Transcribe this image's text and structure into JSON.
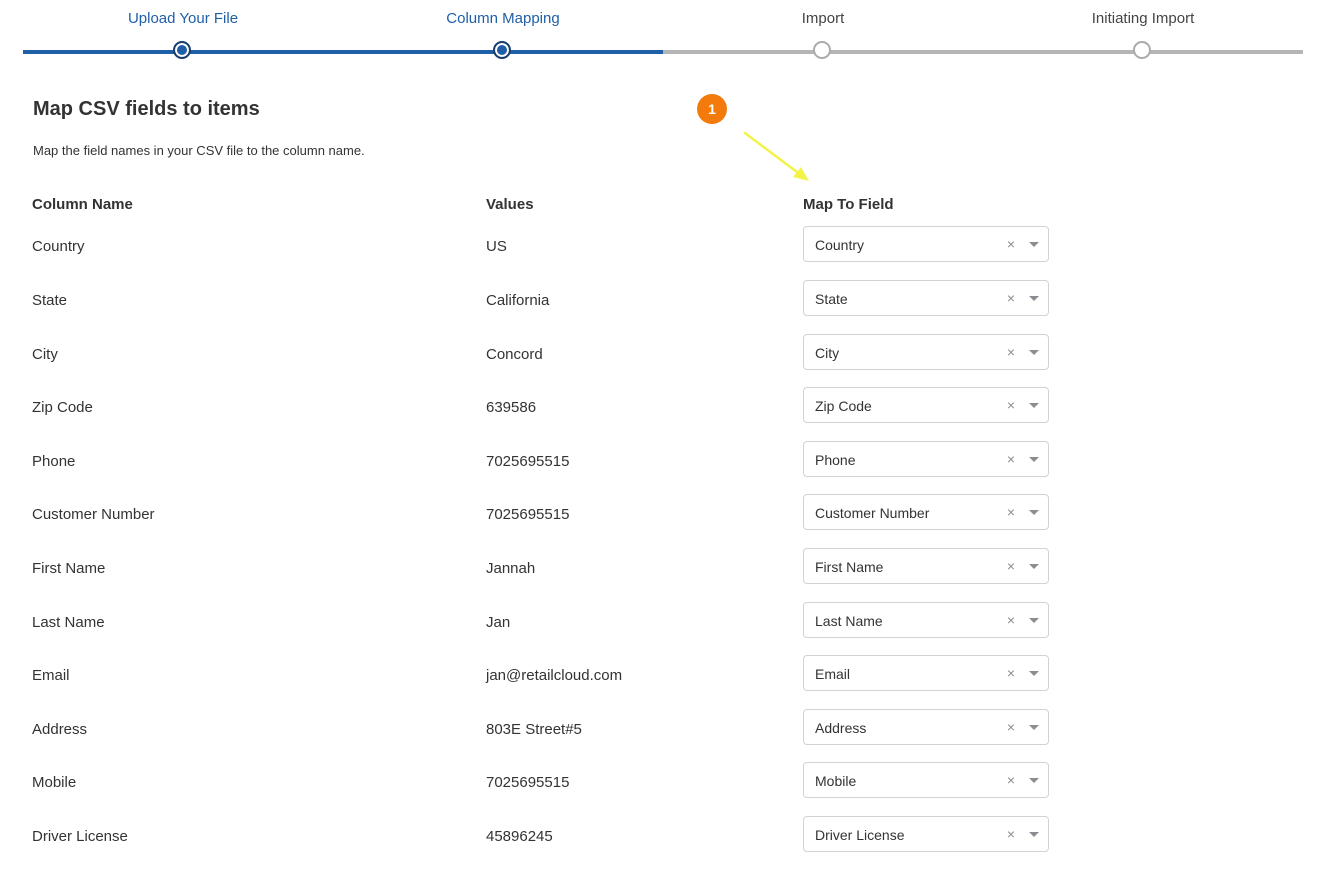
{
  "stepper": {
    "steps": [
      {
        "label": "Upload Your File",
        "state": "done"
      },
      {
        "label": "Column Mapping",
        "state": "done"
      },
      {
        "label": "Import",
        "state": "todo"
      },
      {
        "label": "Initiating Import",
        "state": "todo"
      }
    ],
    "progress_color": "#1f5fa8",
    "inactive_color": "#b3b5b7"
  },
  "header": {
    "title": "Map CSV fields to items",
    "subtitle": "Map the field names in your CSV file to the column name."
  },
  "callout": {
    "number": "1",
    "color": "#f27b0c",
    "arrow_color": "#f3f34a"
  },
  "table": {
    "headers": {
      "column_name": "Column Name",
      "values": "Values",
      "map_to_field": "Map To Field"
    },
    "rows": [
      {
        "name": "Country",
        "value": "US",
        "mapped": "Country"
      },
      {
        "name": "State",
        "value": "California",
        "mapped": "State"
      },
      {
        "name": "City",
        "value": "Concord",
        "mapped": "City"
      },
      {
        "name": "Zip Code",
        "value": "639586",
        "mapped": "Zip Code"
      },
      {
        "name": "Phone",
        "value": "7025695515",
        "mapped": "Phone"
      },
      {
        "name": "Customer Number",
        "value": "7025695515",
        "mapped": "Customer Number"
      },
      {
        "name": "First Name",
        "value": "Jannah",
        "mapped": "First Name"
      },
      {
        "name": "Last Name",
        "value": "Jan",
        "mapped": "Last Name"
      },
      {
        "name": "Email",
        "value": "jan@retailcloud.com",
        "mapped": "Email"
      },
      {
        "name": "Address",
        "value": "803E Street#5",
        "mapped": "Address"
      },
      {
        "name": "Mobile",
        "value": "7025695515",
        "mapped": "Mobile"
      },
      {
        "name": "Driver License",
        "value": "45896245",
        "mapped": "Driver License"
      }
    ],
    "clear_glyph": "×"
  }
}
